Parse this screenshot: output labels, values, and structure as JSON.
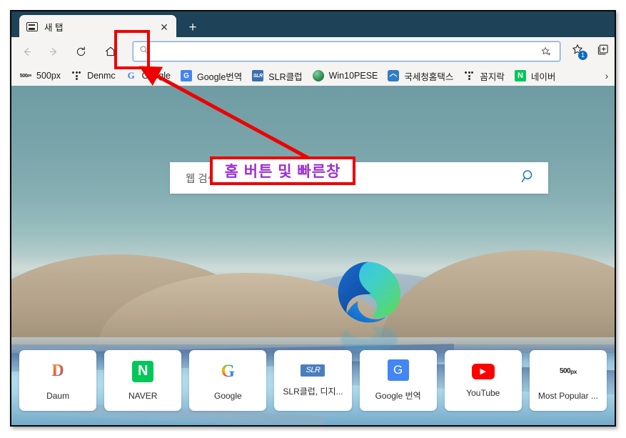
{
  "window": {
    "tab": {
      "title": "새 탭",
      "favicon": "newtab-icon",
      "close_label": "✕"
    },
    "new_tab_button_label": "+"
  },
  "toolbar": {
    "back_label": "back-icon",
    "forward_label": "forward-icon",
    "refresh_label": "refresh-icon",
    "home_label": "home-icon",
    "address": {
      "value": "",
      "placeholder": ""
    },
    "favorites_add_label": "favorite-add-icon",
    "favorites_badge": "1",
    "collections_label": "collections-icon"
  },
  "bookmarks": {
    "items": [
      {
        "label": "500px",
        "icon": "500px-icon"
      },
      {
        "label": "Denmc",
        "icon": "braille-dots-icon"
      },
      {
        "label": "Google",
        "icon": "google-icon"
      },
      {
        "label": "Google번역",
        "icon": "google-translate-icon"
      },
      {
        "label": "SLR클럽",
        "icon": "slr-club-icon"
      },
      {
        "label": "Win10PESE",
        "icon": "globe-icon"
      },
      {
        "label": "국세청홈택스",
        "icon": "hometax-icon"
      },
      {
        "label": "꼼지락",
        "icon": "braille-dots-icon"
      },
      {
        "label": "네이버",
        "icon": "naver-icon"
      }
    ],
    "overflow_label": "›"
  },
  "newtab": {
    "search": {
      "placeholder": "웹 검색",
      "icon": "search-icon"
    },
    "logo": "edge-logo",
    "tiles": [
      {
        "label": "Daum",
        "icon": "daum-icon",
        "glyph": "D"
      },
      {
        "label": "NAVER",
        "icon": "naver-icon",
        "glyph": "N"
      },
      {
        "label": "Google",
        "icon": "google-icon",
        "glyph": "G"
      },
      {
        "label": "SLR클럽, 디지...",
        "icon": "slr-club-icon",
        "glyph": "SLR"
      },
      {
        "label": "Google 번역",
        "icon": "google-translate-icon",
        "glyph": "G"
      },
      {
        "label": "YouTube",
        "icon": "youtube-icon",
        "glyph": "▶"
      },
      {
        "label": "Most Popular ...",
        "icon": "500px-icon",
        "glyph": "500px"
      }
    ]
  },
  "annotations": {
    "callout_text": "홈 버튼 및 빠른창",
    "highlight_target": "home-button",
    "accent_color": "#ee0000",
    "text_color": "#9b30d0"
  }
}
